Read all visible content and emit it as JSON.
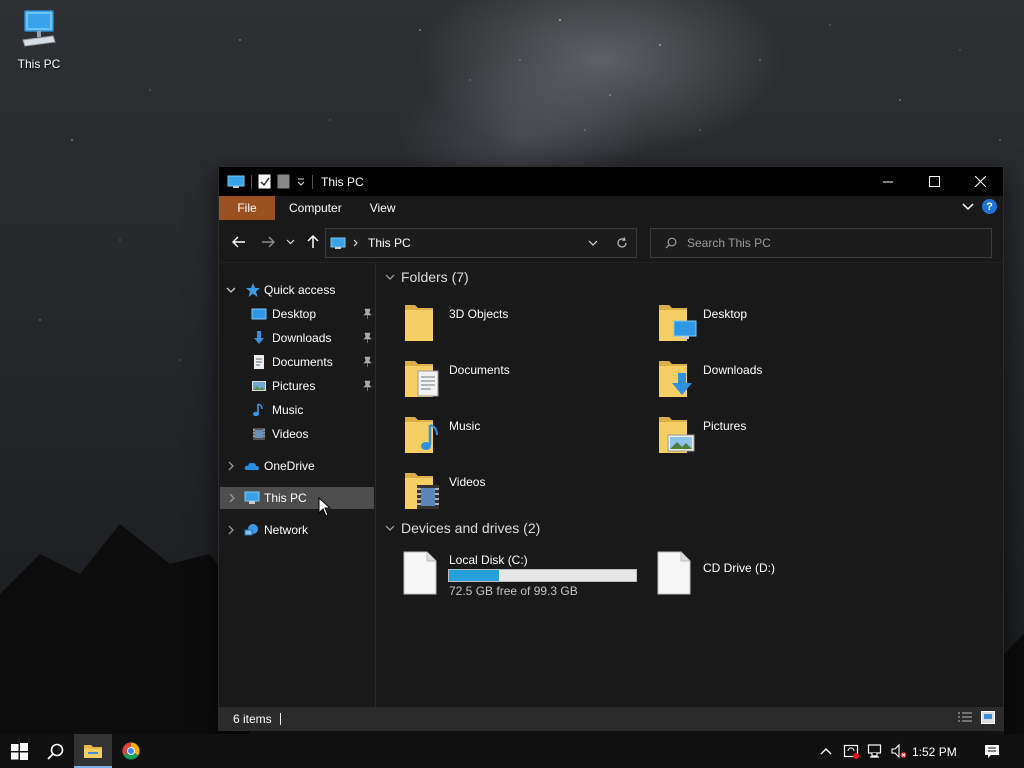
{
  "desktop": {
    "icons": [
      {
        "label": "This PC",
        "icon": "this-pc-icon"
      }
    ]
  },
  "window": {
    "title": "This PC",
    "controls": {
      "minimize": "minimize",
      "maximize": "maximize",
      "close": "close"
    },
    "ribbon": {
      "tabs": [
        "File",
        "Computer",
        "View"
      ],
      "file_tab_color": "#9a5022",
      "help": "?"
    },
    "address": {
      "path": "This PC",
      "search_placeholder": "Search This PC"
    },
    "sidebar": {
      "quick_access": {
        "label": "Quick access",
        "items": [
          {
            "label": "Desktop",
            "icon": "desktop-icon",
            "pinned": true
          },
          {
            "label": "Downloads",
            "icon": "downloads-icon",
            "pinned": true
          },
          {
            "label": "Documents",
            "icon": "documents-icon",
            "pinned": true
          },
          {
            "label": "Pictures",
            "icon": "pictures-icon",
            "pinned": true
          },
          {
            "label": "Music",
            "icon": "music-icon",
            "pinned": false
          },
          {
            "label": "Videos",
            "icon": "videos-icon",
            "pinned": false
          }
        ]
      },
      "onedrive": {
        "label": "OneDrive"
      },
      "this_pc": {
        "label": "This PC",
        "selected": true
      },
      "network": {
        "label": "Network"
      }
    },
    "content": {
      "folders_header": "Folders (7)",
      "folders": [
        {
          "name": "3D Objects",
          "icon": "3d-objects-folder-icon"
        },
        {
          "name": "Desktop",
          "icon": "desktop-folder-icon"
        },
        {
          "name": "Documents",
          "icon": "documents-folder-icon"
        },
        {
          "name": "Downloads",
          "icon": "downloads-folder-icon"
        },
        {
          "name": "Music",
          "icon": "music-folder-icon"
        },
        {
          "name": "Pictures",
          "icon": "pictures-folder-icon"
        },
        {
          "name": "Videos",
          "icon": "videos-folder-icon"
        }
      ],
      "drives_header": "Devices and drives (2)",
      "drives": [
        {
          "name": "Local Disk (C:)",
          "free_text": "72.5 GB free of 99.3 GB",
          "used_fraction": 0.27,
          "bar_color": "#26a0da"
        },
        {
          "name": "CD Drive (D:)"
        }
      ]
    },
    "status": {
      "items": "6 items"
    }
  },
  "taskbar": {
    "clock": "1:52 PM",
    "buttons": [
      "start-icon",
      "search-icon",
      "file-explorer-icon",
      "chrome-icon"
    ],
    "tray": [
      "chevron-up-icon",
      "security-icon",
      "network-icon",
      "volume-muted-icon",
      "notification-icon"
    ]
  }
}
